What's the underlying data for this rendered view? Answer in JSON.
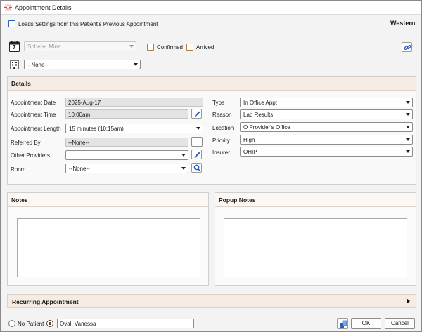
{
  "window": {
    "title": "Appointment Details"
  },
  "header": {
    "load_settings_label": "Loads Settings from this Patient's Previous Appointment",
    "region": "Western"
  },
  "top": {
    "calendar_day": "7",
    "provider_value": "Sphere, Mina",
    "confirmed_label": "Confirmed",
    "arrived_label": "Arrived",
    "location_value": "--None--"
  },
  "details": {
    "heading": "Details",
    "appointment_date": {
      "label": "Appointment Date",
      "value": "2025-Aug-17"
    },
    "appointment_time": {
      "label": "Appointment Time",
      "value": "10:00am"
    },
    "appointment_length": {
      "label": "Appointment Length",
      "value": "15 minutes (10:15am)"
    },
    "referred_by": {
      "label": "Referred By",
      "value": "--None--",
      "button": "..."
    },
    "other_providers": {
      "label": "Other Providers",
      "value": ""
    },
    "room": {
      "label": "Room",
      "value": "--None--"
    },
    "type": {
      "label": "Type",
      "value": "In Office Appt"
    },
    "reason": {
      "label": "Reason",
      "value": "Lab Results"
    },
    "location": {
      "label": "Location",
      "value": "O Provider's Office"
    },
    "priority": {
      "label": "Priority",
      "value": "High"
    },
    "insurer": {
      "label": "Insurer",
      "value": "OHIP"
    }
  },
  "notes": {
    "heading": "Notes",
    "value": ""
  },
  "popup_notes": {
    "heading": "Popup Notes",
    "value": ""
  },
  "recurring": {
    "heading": "Recurring Appointment"
  },
  "footer": {
    "no_patient_label": "No Patient",
    "patient_value": "Oval, Vanessa",
    "ok_label": "OK",
    "cancel_label": "Cancel"
  },
  "colors": {
    "accent": "#2b5fb8",
    "panel_header": "#f7ece3"
  }
}
